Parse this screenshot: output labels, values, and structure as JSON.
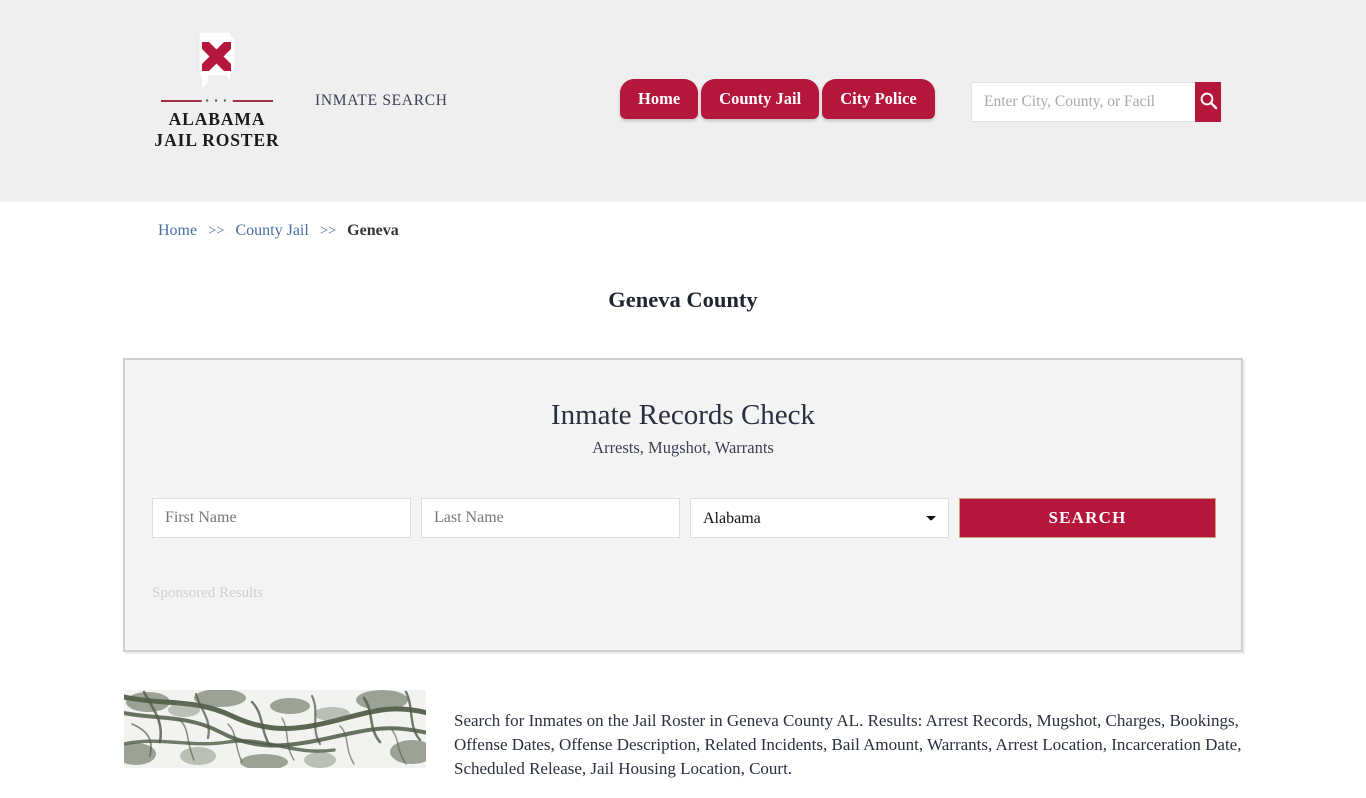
{
  "header": {
    "logo": {
      "icon": "alabama-flag-state-icon",
      "divider_dots": "▪ ▪ ▪",
      "line1": "ALABAMA",
      "line2": "JAIL ROSTER"
    },
    "tagline": "INMATE SEARCH",
    "nav": [
      {
        "label": "Home",
        "name": "nav-tab-home"
      },
      {
        "label": "County Jail",
        "name": "nav-tab-county-jail"
      },
      {
        "label": "City Police",
        "name": "nav-tab-city-police"
      }
    ],
    "search": {
      "placeholder": "Enter City, County, or Facil",
      "value": "",
      "button_icon": "search-icon"
    },
    "background_color": "#efefef",
    "accent_color": "#b4163c"
  },
  "breadcrumb": {
    "items": [
      {
        "label": "Home",
        "is_link": true
      },
      {
        "label": "County Jail",
        "is_link": true
      },
      {
        "label": "Geneva",
        "is_link": false
      }
    ],
    "separator": ">>"
  },
  "page_title": "Geneva County",
  "panel": {
    "title": "Inmate Records Check",
    "subtitle": "Arrests, Mugshot, Warrants",
    "form": {
      "first_name_placeholder": "First Name",
      "first_name_value": "",
      "last_name_placeholder": "Last Name",
      "last_name_value": "",
      "state_selected": "Alabama",
      "state_options": [
        "Alabama"
      ],
      "search_button": "SEARCH"
    },
    "sponsored_label": "Sponsored Results"
  },
  "bottom": {
    "image_alt": "tree-branches-photo",
    "description": "Search for Inmates on the Jail Roster in Geneva County AL. Results: Arrest Records, Mugshot, Charges, Bookings, Offense Dates, Offense Description, Related Incidents, Bail Amount, Warrants, Arrest Location, Incarceration Date, Scheduled Release, Jail Housing Location, Court."
  }
}
